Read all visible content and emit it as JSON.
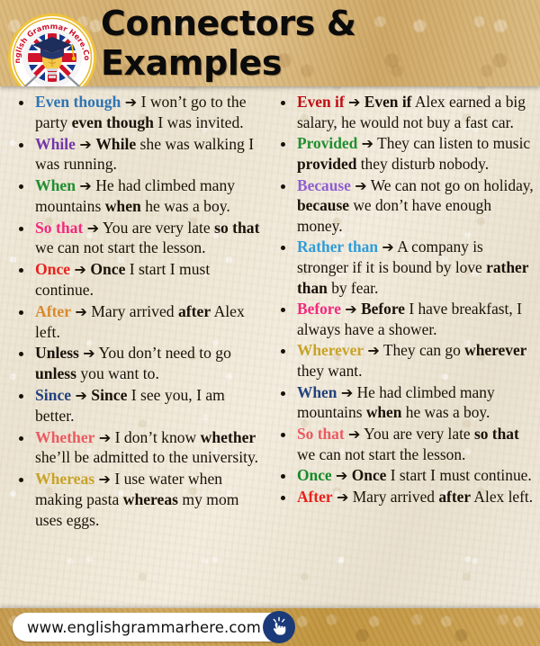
{
  "header": {
    "title": "Connectors & Examples",
    "logo": {
      "name": "english-grammar-here-logo",
      "curved_text": "English Grammar Here.Com"
    }
  },
  "colors": {
    "header_band": "#d5b174",
    "page_background": "#efe8d6",
    "footer_band": "#c79d52",
    "title_text": "#0b0b0b",
    "body_text": "#1a1208",
    "badge_blue": "#1b3a7a"
  },
  "arrow_glyph": "➔",
  "left_column": {
    "items": [
      {
        "keyword": "Even though",
        "keyword_color": "#2f74b5",
        "parts": [
          {
            "text": "I won’t go to the party ",
            "bold": false
          },
          {
            "text": "even though",
            "bold": true
          },
          {
            "text": " I was invited.",
            "bold": false
          }
        ]
      },
      {
        "keyword": "While",
        "keyword_color": "#7236a8",
        "parts": [
          {
            "text": "While",
            "bold": true
          },
          {
            "text": " she was walking I was running.",
            "bold": false
          }
        ]
      },
      {
        "keyword": "When",
        "keyword_color": "#1f8f2f",
        "parts": [
          {
            "text": "He had climbed many mountains ",
            "bold": false
          },
          {
            "text": "when",
            "bold": true
          },
          {
            "text": " he was a boy.",
            "bold": false
          }
        ]
      },
      {
        "keyword": "So that",
        "keyword_color": "#f3297c",
        "parts": [
          {
            "text": "You are very late ",
            "bold": false
          },
          {
            "text": "so that",
            "bold": true
          },
          {
            "text": " we can not start the lesson.",
            "bold": false
          }
        ]
      },
      {
        "keyword": "Once",
        "keyword_color": "#e8221c",
        "parts": [
          {
            "text": "Once",
            "bold": true
          },
          {
            "text": " I start I must continue.",
            "bold": false
          }
        ]
      },
      {
        "keyword": "After",
        "keyword_color": "#d9892b",
        "parts": [
          {
            "text": "Mary arrived ",
            "bold": false
          },
          {
            "text": "after",
            "bold": true
          },
          {
            "text": " Alex left.",
            "bold": false
          }
        ]
      },
      {
        "keyword": "Unless",
        "keyword_color": "#17110a",
        "parts": [
          {
            "text": "You don’t need to go ",
            "bold": false
          },
          {
            "text": "unless",
            "bold": true
          },
          {
            "text": " you want to.",
            "bold": false
          }
        ]
      },
      {
        "keyword": "Since",
        "keyword_color": "#22417e",
        "parts": [
          {
            "text": "Since",
            "bold": true
          },
          {
            "text": " I see you, I am better.",
            "bold": false
          }
        ]
      },
      {
        "keyword": "Whether",
        "keyword_color": "#ea5a62",
        "parts": [
          {
            "text": "I don’t know ",
            "bold": false
          },
          {
            "text": "whether",
            "bold": true
          },
          {
            "text": " she’ll be admitted to the university.",
            "bold": false
          }
        ]
      },
      {
        "keyword": "Whereas",
        "keyword_color": "#c8a227",
        "parts": [
          {
            "text": "I use water when making pasta ",
            "bold": false
          },
          {
            "text": "whereas",
            "bold": true
          },
          {
            "text": " my mom uses eggs.",
            "bold": false
          }
        ]
      }
    ]
  },
  "right_column": {
    "items": [
      {
        "keyword": "Even if",
        "keyword_color": "#bd0e14",
        "parts": [
          {
            "text": "Even if",
            "bold": true
          },
          {
            "text": " Alex earned a big salary, he would not buy a fast car.",
            "bold": false
          }
        ]
      },
      {
        "keyword": "Provided",
        "keyword_color": "#1f8f2f",
        "parts": [
          {
            "text": "They can listen to music ",
            "bold": false
          },
          {
            "text": "provided",
            "bold": true
          },
          {
            "text": " they disturb nobody.",
            "bold": false
          }
        ]
      },
      {
        "keyword": "Because",
        "keyword_color": "#8e5fd0",
        "parts": [
          {
            "text": "We can not go on holiday, ",
            "bold": false
          },
          {
            "text": "because",
            "bold": true
          },
          {
            "text": " we don’t have enough money.",
            "bold": false
          }
        ]
      },
      {
        "keyword": "Rather than",
        "keyword_color": "#2f9cd8",
        "parts": [
          {
            "text": "A company is stronger if it is bound by love ",
            "bold": false
          },
          {
            "text": "rather than",
            "bold": true
          },
          {
            "text": " by fear.",
            "bold": false
          }
        ]
      },
      {
        "keyword": "Before",
        "keyword_color": "#f3297c",
        "parts": [
          {
            "text": "Before",
            "bold": true
          },
          {
            "text": " I have breakfast, I always have a shower.",
            "bold": false
          }
        ]
      },
      {
        "keyword": "Wherever",
        "keyword_color": "#c8a227",
        "parts": [
          {
            "text": "They can go ",
            "bold": false
          },
          {
            "text": "wherever",
            "bold": true
          },
          {
            "text": " they want.",
            "bold": false
          }
        ]
      },
      {
        "keyword": "When",
        "keyword_color": "#22417e",
        "parts": [
          {
            "text": "He had climbed many mountains ",
            "bold": false
          },
          {
            "text": "when",
            "bold": true
          },
          {
            "text": " he was a boy.",
            "bold": false
          }
        ]
      },
      {
        "keyword": "So that",
        "keyword_color": "#ea5a62",
        "parts": [
          {
            "text": "You are very late ",
            "bold": false
          },
          {
            "text": "so that",
            "bold": true
          },
          {
            "text": " we can not start the lesson.",
            "bold": false
          }
        ]
      },
      {
        "keyword": "Once",
        "keyword_color": "#15892b",
        "parts": [
          {
            "text": "Once",
            "bold": true
          },
          {
            "text": " I start I must continue.",
            "bold": false
          }
        ]
      },
      {
        "keyword": "After",
        "keyword_color": "#e8221c",
        "parts": [
          {
            "text": "Mary arrived ",
            "bold": false
          },
          {
            "text": "after",
            "bold": true
          },
          {
            "text": " Alex left.",
            "bold": false
          }
        ]
      }
    ]
  },
  "footer": {
    "url": "www.englishgrammarhere.com",
    "click_icon": "pointing-hand-click-icon"
  }
}
